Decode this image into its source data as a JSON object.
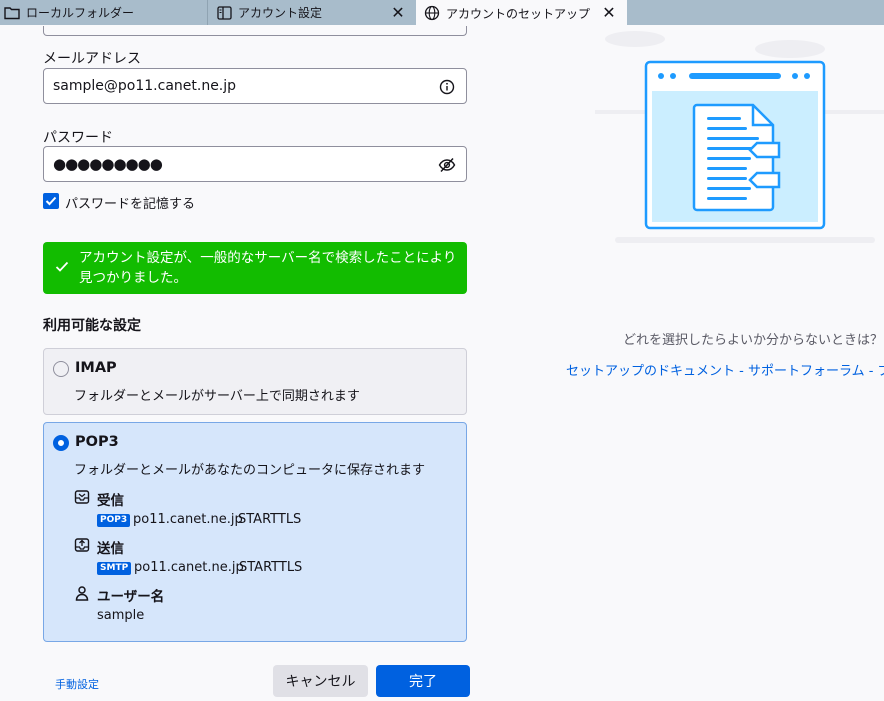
{
  "tabs": [
    {
      "label": "ローカルフォルダー",
      "icon": "folder-icon"
    },
    {
      "label": "アカウント設定",
      "icon": "book-icon"
    },
    {
      "label": "アカウントのセットアップ",
      "icon": "globe-icon"
    }
  ],
  "form": {
    "email_label": "メールアドレス",
    "email_value": "sample@po11.canet.ne.jp",
    "password_label": "パスワード",
    "password_value": "●●●●●●●●●",
    "remember_label": "パスワードを記憶する",
    "remember_checked": true
  },
  "success_message": "アカウント設定が、一般的なサーバー名で検索したことにより見つかりました。",
  "available_title": "利用可能な設定",
  "imap": {
    "name": "IMAP",
    "description": "フォルダーとメールがサーバー上で同期されます"
  },
  "pop3": {
    "name": "POP3",
    "description": "フォルダーとメールがあなたのコンピュータに保存されます",
    "incoming_title": "受信",
    "incoming_badge": "POP3",
    "incoming_host": "po11.canet.ne.jp",
    "incoming_security": "STARTTLS",
    "outgoing_title": "送信",
    "outgoing_badge": "SMTP",
    "outgoing_host": "po11.canet.ne.jp",
    "outgoing_security": "STARTTLS",
    "username_title": "ユーザー名",
    "username_value": "sample"
  },
  "footer": {
    "manual_link": "手動設定",
    "cancel_label": "キャンセル",
    "done_label": "完了"
  },
  "help": {
    "question": "どれを選択したらよいか分からないときは？",
    "links": "セットアップのドキュメント - サポートフォーラム - プライバシーポリシー"
  },
  "colors": {
    "accent": "#0061e0",
    "success": "#12bc00",
    "tabbar": "#a8bccb"
  }
}
